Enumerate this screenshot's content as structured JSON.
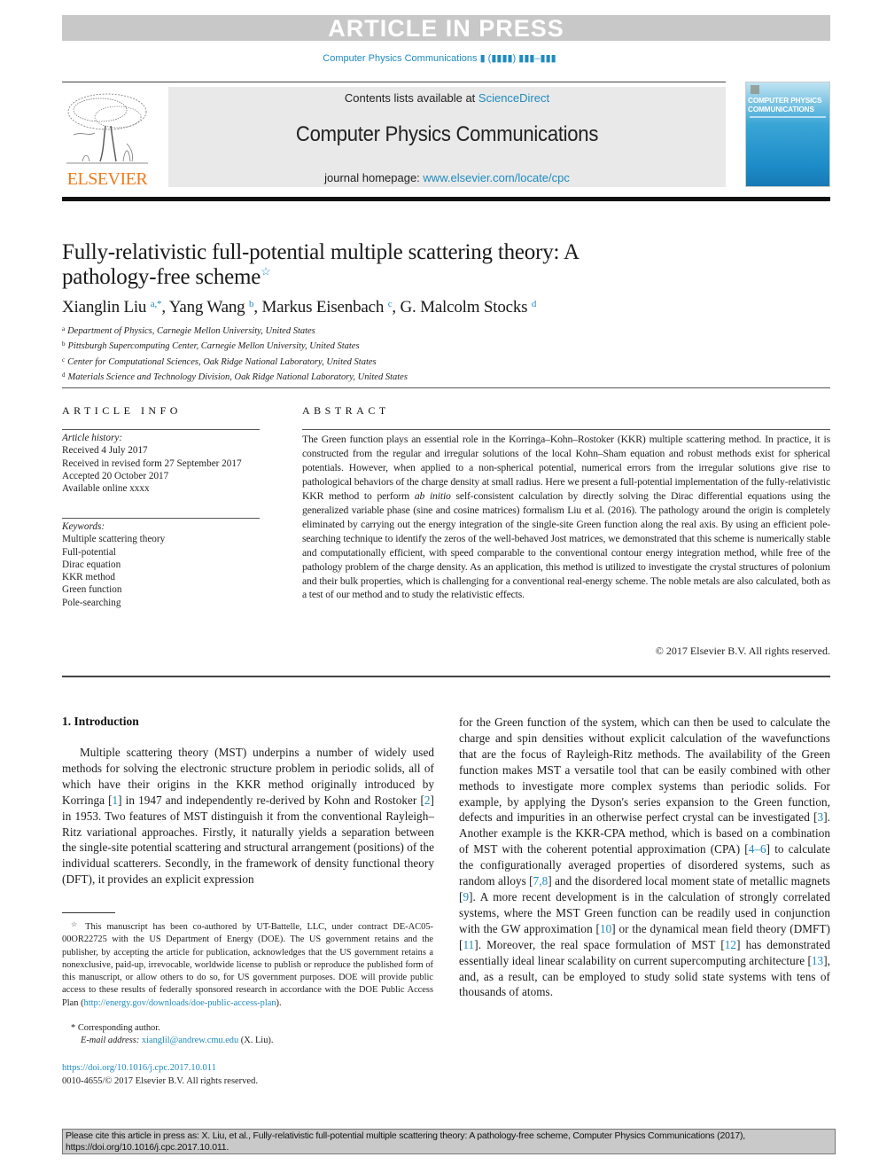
{
  "banner": {
    "text": "ARTICLE IN PRESS"
  },
  "journal_ref": {
    "text": "Computer Physics Communications ▮ (▮▮▮▮) ▮▮▮–▮▮▮"
  },
  "header": {
    "publisher_logo": {
      "icon": "elsevier-tree-icon",
      "wordmark": "ELSEVIER",
      "color": "#f07b1d"
    },
    "contents_prefix": "Contents lists available at ",
    "contents_link": "ScienceDirect",
    "journal_name": "Computer Physics Communications",
    "homepage_prefix": "journal homepage: ",
    "homepage_link": "www.elsevier.com/locate/cpc",
    "cover": {
      "title_line1": "COMPUTER PHYSICS",
      "title_line2": "COMMUNICATIONS"
    }
  },
  "article": {
    "title_line1": "Fully-relativistic full-potential multiple scattering theory: A",
    "title_line2": "pathology-free scheme",
    "title_note_mark": "☆",
    "authors": [
      {
        "name": "Xianglin Liu",
        "sup": "a,*",
        "sep": ", "
      },
      {
        "name": "Yang Wang",
        "sup": "b",
        "sep": ", "
      },
      {
        "name": "Markus Eisenbach",
        "sup": "c",
        "sep": ", "
      },
      {
        "name": "G. Malcolm Stocks",
        "sup": "d",
        "sep": ""
      }
    ],
    "affiliations": [
      {
        "label": "a",
        "text": "Department of Physics, Carnegie Mellon University, United States"
      },
      {
        "label": "b",
        "text": "Pittsburgh Supercomputing Center, Carnegie Mellon University, United States"
      },
      {
        "label": "c",
        "text": "Center for Computational Sciences, Oak Ridge National Laboratory, United States"
      },
      {
        "label": "d",
        "text": "Materials Science and Technology Division, Oak Ridge National Laboratory, United States"
      }
    ]
  },
  "article_info": {
    "label": "ARTICLE INFO",
    "history_head": "Article history:",
    "history": [
      "Received 4 July 2017",
      "Received in revised form 27 September 2017",
      "Accepted 20 October 2017",
      "Available online xxxx"
    ],
    "keywords_head": "Keywords:",
    "keywords": [
      "Multiple scattering theory",
      "Full-potential",
      "Dirac equation",
      "KKR method",
      "Green function",
      "Pole-searching"
    ]
  },
  "abstract": {
    "label": "ABSTRACT",
    "text_part1": "The Green function plays an essential role in the Korringa–Kohn–Rostoker (KKR) multiple scattering method. In practice, it is constructed from the regular and irregular solutions of the local Kohn–Sham equation and robust methods exist for spherical potentials. However, when applied to a non-spherical potential, numerical errors from the irregular solutions give rise to pathological behaviors of the charge density at small radius. Here we present a full-potential implementation of the fully-relativistic KKR method to perform ",
    "text_italic": "ab initio",
    "text_part2": " self-consistent calculation by directly solving the Dirac differential equations using the generalized variable phase (sine and cosine matrices) formalism Liu et al. (2016). The pathology around the origin is completely eliminated by carrying out the energy integration of the single-site Green function along the real axis. By using an efficient pole-searching technique to identify the zeros of the well-behaved Jost matrices, we demonstrated that this scheme is numerically stable and computationally efficient, with speed comparable to the conventional contour energy integration method, while free of the pathology problem of the charge density. As an application, this method is utilized to investigate the crystal structures of polonium and their bulk properties, which is challenging for a conventional real-energy scheme. The noble metals are also calculated, both as a test of our method and to study the relativistic effects.",
    "copyright": "© 2017 Elsevier B.V. All rights reserved."
  },
  "introduction": {
    "heading": "1.  Introduction",
    "left_segments": [
      {
        "t": "Multiple scattering theory (MST) underpins a number of widely used methods for solving the electronic structure problem in periodic solids, all of which have their origins in the KKR method originally introduced by Korringa ["
      },
      {
        "ref": "1"
      },
      {
        "t": "] in 1947 and independently re-derived by Kohn and Rostoker ["
      },
      {
        "ref": "2"
      },
      {
        "t": "] in 1953. Two features of MST distinguish it from the conventional Rayleigh–Ritz variational approaches. Firstly, it naturally yields a separation between the single-site potential scattering and structural arrangement (positions) of the individual scatterers. Secondly, in the framework of density functional theory (DFT), it provides an explicit expression"
      }
    ],
    "right_segments": [
      {
        "t": "for the Green function of the system, which can then be used to calculate the charge and spin densities without explicit calculation of the wavefunctions that are the focus of Rayleigh-Ritz methods. The availability of the Green function makes MST a versatile tool that can be easily combined with other methods to investigate more complex systems than periodic solids. For example, by applying the Dyson's series expansion to the Green function, defects and impurities in an otherwise perfect crystal can be investigated ["
      },
      {
        "ref": "3"
      },
      {
        "t": "]. Another example is the KKR-CPA method, which is based on a combination of MST with the coherent potential approximation (CPA) ["
      },
      {
        "ref": "4–6"
      },
      {
        "t": "] to calculate the configurationally averaged properties of disordered systems, such as random alloys ["
      },
      {
        "ref": "7,8"
      },
      {
        "t": "] and the disordered local moment state of metallic magnets ["
      },
      {
        "ref": "9"
      },
      {
        "t": "]. A more recent development is in the calculation of strongly correlated systems, where the MST Green function can be readily used in conjunction with the GW approximation ["
      },
      {
        "ref": "10"
      },
      {
        "t": "] or the dynamical mean field theory (DMFT) ["
      },
      {
        "ref": "11"
      },
      {
        "t": "]. Moreover, the real space formulation of MST ["
      },
      {
        "ref": "12"
      },
      {
        "t": "] has demonstrated essentially ideal linear scalability on current supercomputing architecture ["
      },
      {
        "ref": "13"
      },
      {
        "t": "], and, as a result, can be employed to study solid state systems with tens of thousands of atoms."
      }
    ]
  },
  "footnotes": {
    "funding_mark": "☆",
    "funding_text": "This manuscript has been co-authored by UT-Battelle, LLC, under contract DE-AC05-00OR22725 with the US Department of Energy (DOE). The US government retains and the publisher, by accepting the article for publication, acknowledges that the US government retains a nonexclusive, paid-up, irrevocable, worldwide license to publish or reproduce the published form of this manuscript, or allow others to do so, for US government purposes. DOE will provide public access to these results of federally sponsored research in accordance with the DOE Public Access Plan (",
    "funding_link": "http://energy.gov/downloads/doe-public-access-plan",
    "funding_end": ").",
    "corr_mark": "*",
    "corr_text": "Corresponding author.",
    "email_label": "E-mail address:",
    "email": "xianglil@andrew.cmu.edu",
    "email_suffix": " (X. Liu).",
    "doi": "https://doi.org/10.1016/j.cpc.2017.10.011",
    "issn_line": "0010-4655/© 2017 Elsevier B.V. All rights reserved."
  },
  "citation_box": {
    "text": "Please cite this article in press as: X. Liu, et al., Fully-relativistic full-potential multiple scattering theory: A pathology-free scheme, Computer Physics Communications (2017), https://doi.org/10.1016/j.cpc.2017.10.011."
  }
}
